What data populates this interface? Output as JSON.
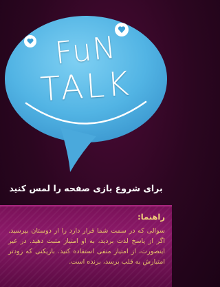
{
  "logo": {
    "line1": "FuN",
    "line2": "TALK"
  },
  "start_prompt": "برای شروع بازی صفحه را لمس کنید",
  "guide": {
    "title": "راهنما:",
    "text": "سوالی که در سمت شما قرار دارد را از دوستان بپرسید. اگر از پاسخ لذت بردید، به او امتیاز مثبت دهید. در غیر اینصورت، از امتیاز منفی استفاده کنید. بازیکنی که زودتر امتیازش به قلب برسد، برنده است."
  },
  "colors": {
    "background": "#2b0620",
    "bubble": "#5ab8e6",
    "heart": "#ffffff",
    "heart_accent": "#3a9fd6",
    "panel": "#7a1159",
    "panel_text": "#e8c46a"
  },
  "icons": {
    "heart_left": "heart-icon",
    "heart_right": "heart-icon"
  }
}
